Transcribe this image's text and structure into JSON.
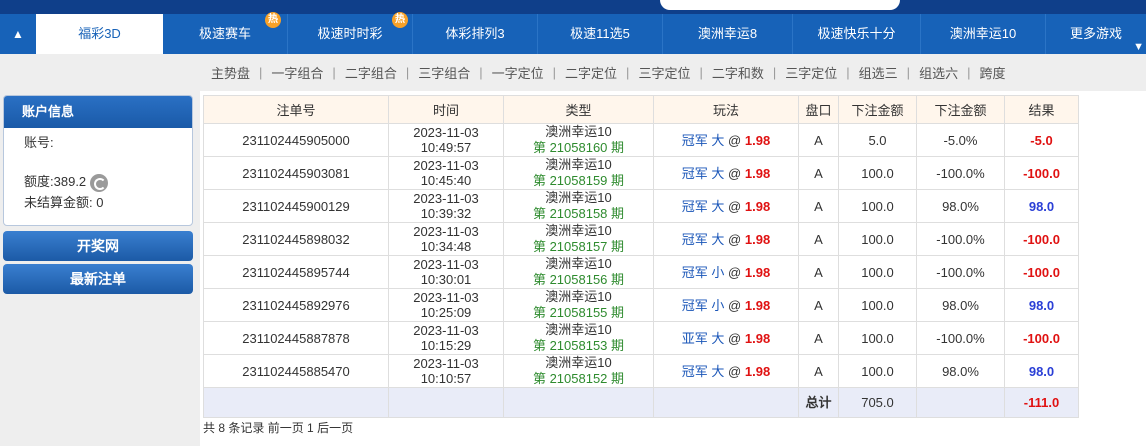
{
  "nav": {
    "items": [
      {
        "label": "福彩3D",
        "active": true,
        "hot": false
      },
      {
        "label": "极速赛车",
        "active": false,
        "hot": true
      },
      {
        "label": "极速时时彩",
        "active": false,
        "hot": true
      },
      {
        "label": "体彩排列3",
        "active": false,
        "hot": false
      },
      {
        "label": "极速11选5",
        "active": false,
        "hot": false
      },
      {
        "label": "澳洲幸运8",
        "active": false,
        "hot": false
      },
      {
        "label": "极速快乐十分",
        "active": false,
        "hot": false
      },
      {
        "label": "澳洲幸运10",
        "active": false,
        "hot": false
      },
      {
        "label": "更多游戏",
        "active": false,
        "hot": false
      }
    ],
    "hot_badge": "热"
  },
  "subnav": [
    "主势盘",
    "一字组合",
    "二字组合",
    "三字组合",
    "一字定位",
    "二字定位",
    "三字定位",
    "二字和数",
    "三字定位",
    "组选三",
    "组选六",
    "跨度"
  ],
  "account": {
    "title": "账户信息",
    "account_label": "账号:",
    "quota_label": "额度:",
    "quota_value": "389.2",
    "unsettled_label": "未结算金额:",
    "unsettled_value": "0"
  },
  "buttons": {
    "lottery_site": "开奖网",
    "latest_bets": "最新注单"
  },
  "table": {
    "headers": [
      "注单号",
      "时间",
      "类型",
      "玩法",
      "盘口",
      "下注金额",
      "下注金额",
      "结果"
    ],
    "rows": [
      {
        "id": "231102445905000",
        "date": "2023-11-03",
        "time": "10:49:57",
        "type": "澳洲幸运10",
        "issue": "第 21058160 期",
        "play": "冠军 大",
        "at": "@",
        "odds": "1.98",
        "pan": "A",
        "amount": "5.0",
        "pct": "-5.0%",
        "result": "-5.0",
        "win": false
      },
      {
        "id": "231102445903081",
        "date": "2023-11-03",
        "time": "10:45:40",
        "type": "澳洲幸运10",
        "issue": "第 21058159 期",
        "play": "冠军 大",
        "at": "@",
        "odds": "1.98",
        "pan": "A",
        "amount": "100.0",
        "pct": "-100.0%",
        "result": "-100.0",
        "win": false
      },
      {
        "id": "231102445900129",
        "date": "2023-11-03",
        "time": "10:39:32",
        "type": "澳洲幸运10",
        "issue": "第 21058158 期",
        "play": "冠军 大",
        "at": "@",
        "odds": "1.98",
        "pan": "A",
        "amount": "100.0",
        "pct": "98.0%",
        "result": "98.0",
        "win": true
      },
      {
        "id": "231102445898032",
        "date": "2023-11-03",
        "time": "10:34:48",
        "type": "澳洲幸运10",
        "issue": "第 21058157 期",
        "play": "冠军 大",
        "at": "@",
        "odds": "1.98",
        "pan": "A",
        "amount": "100.0",
        "pct": "-100.0%",
        "result": "-100.0",
        "win": false
      },
      {
        "id": "231102445895744",
        "date": "2023-11-03",
        "time": "10:30:01",
        "type": "澳洲幸运10",
        "issue": "第 21058156 期",
        "play": "冠军 小",
        "at": "@",
        "odds": "1.98",
        "pan": "A",
        "amount": "100.0",
        "pct": "-100.0%",
        "result": "-100.0",
        "win": false
      },
      {
        "id": "231102445892976",
        "date": "2023-11-03",
        "time": "10:25:09",
        "type": "澳洲幸运10",
        "issue": "第 21058155 期",
        "play": "冠军 小",
        "at": "@",
        "odds": "1.98",
        "pan": "A",
        "amount": "100.0",
        "pct": "98.0%",
        "result": "98.0",
        "win": true
      },
      {
        "id": "231102445887878",
        "date": "2023-11-03",
        "time": "10:15:29",
        "type": "澳洲幸运10",
        "issue": "第 21058153 期",
        "play": "亚军 大",
        "at": "@",
        "odds": "1.98",
        "pan": "A",
        "amount": "100.0",
        "pct": "-100.0%",
        "result": "-100.0",
        "win": false
      },
      {
        "id": "231102445885470",
        "date": "2023-11-03",
        "time": "10:10:57",
        "type": "澳洲幸运10",
        "issue": "第 21058152 期",
        "play": "冠军 大",
        "at": "@",
        "odds": "1.98",
        "pan": "A",
        "amount": "100.0",
        "pct": "98.0%",
        "result": "98.0",
        "win": true
      }
    ],
    "total_label": "总计",
    "total_amount": "705.0",
    "total_result": "-111.0"
  },
  "pager": {
    "records": "共 8 条记录",
    "prev": "前一页",
    "page": "1",
    "next": "后一页"
  },
  "colors": {
    "nav_blue": "#1762b8",
    "loss_red": "#e01111",
    "win_blue": "#2a3fd6",
    "issue_green": "#2e8b2e",
    "hot_orange": "#f7a128"
  }
}
